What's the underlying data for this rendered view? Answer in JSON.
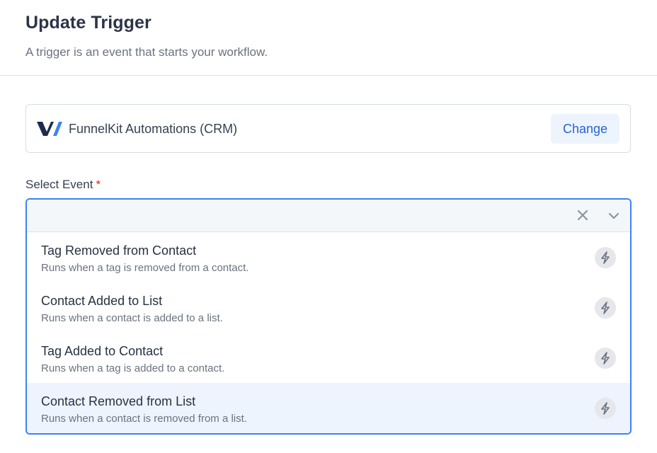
{
  "header": {
    "title": "Update Trigger",
    "subtitle": "A trigger is an event that starts your workflow."
  },
  "integration": {
    "name": "FunnelKit Automations (CRM)",
    "change_label": "Change",
    "logo_icon": "funnelkit-logo"
  },
  "event_field": {
    "label": "Select Event",
    "required_mark": "*",
    "value": "",
    "clear_icon": "close-icon",
    "toggle_icon": "chevron-down-icon",
    "options": [
      {
        "title": "Tag Removed from Contact",
        "description": "Runs when a tag is removed from a contact.",
        "icon": "lightning-icon",
        "highlighted": false
      },
      {
        "title": "Contact Added to List",
        "description": "Runs when a contact is added to a list.",
        "icon": "lightning-icon",
        "highlighted": false
      },
      {
        "title": "Tag Added to Contact",
        "description": "Runs when a tag is added to a contact.",
        "icon": "lightning-icon",
        "highlighted": false
      },
      {
        "title": "Contact Removed from List",
        "description": "Runs when a contact is removed from a list.",
        "icon": "lightning-icon",
        "highlighted": true
      }
    ]
  },
  "colors": {
    "accent": "#3b82f6",
    "button_text": "#2563d6",
    "button_bg": "#eef4fe",
    "required": "#dc2626",
    "logo_dark": "#1e2b4f",
    "logo_blue": "#3b82f6"
  }
}
